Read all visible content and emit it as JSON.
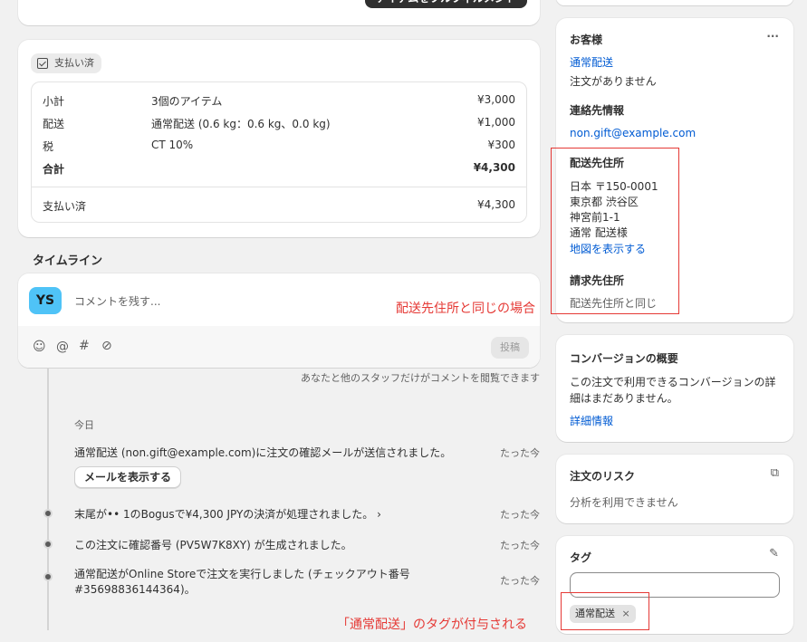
{
  "fulfill_button": "アイテムをフルフィルメント",
  "payment": {
    "badge": "支払い済",
    "rows": [
      {
        "label": "小計",
        "desc": "3個のアイテム",
        "amount": "¥3,000"
      },
      {
        "label": "配送",
        "desc": "通常配送 (0.6 kg：0.6 kg、0.0 kg)",
        "amount": "¥1,000"
      },
      {
        "label": "税",
        "desc": "CT 10%",
        "amount": "¥300"
      },
      {
        "label": "合計",
        "desc": "",
        "amount": "¥4,300"
      }
    ],
    "paid_label": "支払い済",
    "paid_amount": "¥4,300"
  },
  "timeline": {
    "title": "タイムライン",
    "avatar": "YS",
    "comment_placeholder": "コメントを残す...",
    "post_button": "投稿",
    "visibility_note": "あなたと他のスタッフだけがコメントを閲覧できます",
    "day_label": "今日",
    "events": [
      {
        "text": "通常配送 (non.gift@example.com)に注文の確認メールが送信されました。",
        "time": "たった今",
        "button": "メールを表示する"
      },
      {
        "text": "末尾が•• 1のBogusで¥4,300 JPYの決済が処理されました。 ›",
        "time": "たった今"
      },
      {
        "text": "この注文に確認番号 (PV5W7K8XY) が生成されました。",
        "time": "たった今"
      },
      {
        "text_line1": "通常配送がOnline Storeで注文を実行しました (チェックアウト番号",
        "text_line2": "#35698836144364)。",
        "time": "たった今"
      }
    ]
  },
  "customer": {
    "title": "お客様",
    "more": "···",
    "name": "通常配送",
    "orders": "注文がありません",
    "contact_title": "連絡先情報",
    "email": "non.gift@example.com",
    "shipping_title": "配送先住所",
    "address": [
      "日本 〒150-0001",
      "東京都 渋谷区",
      "神宮前1-1",
      "通常 配送様"
    ],
    "map_link": "地図を表示する",
    "billing_title": "請求先住所",
    "billing_value": "配送先住所と同じ"
  },
  "conversion": {
    "title": "コンバージョンの概要",
    "text_line1": "この注文で利用できるコンバージョンの詳",
    "text_line2": "細はまだありません。",
    "link": "詳細情報"
  },
  "risk": {
    "title": "注文のリスク",
    "text": "分析を利用できません"
  },
  "tags": {
    "title": "タグ",
    "chip": "通常配送",
    "chip_remove": "×"
  },
  "annotations": {
    "billing_note": "配送先住所と同じの場合",
    "tag_note": "「通常配送」のタグが付与される"
  },
  "colors": {
    "accent_link": "#005bd3",
    "annotation_red": "#e53935",
    "avatar_bg": "#4fc3f7"
  }
}
